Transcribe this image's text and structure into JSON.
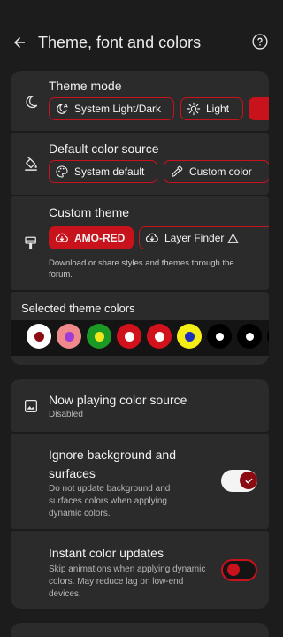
{
  "header": {
    "title": "Theme, font and colors",
    "back_icon": "arrow-back-icon",
    "help_icon": "help-circle-icon"
  },
  "theme_mode": {
    "title": "Theme mode",
    "icon": "moon-icon",
    "options": [
      {
        "label": "System Light/Dark",
        "icon": "moon-auto-icon"
      },
      {
        "label": "Light",
        "icon": "sun-icon"
      }
    ]
  },
  "default_color_source": {
    "title": "Default color source",
    "icon": "paint-bucket-icon",
    "options": [
      {
        "label": "System default",
        "icon": "palette-icon"
      },
      {
        "label": "Custom color",
        "icon": "eyedropper-icon"
      }
    ]
  },
  "custom_theme": {
    "title": "Custom theme",
    "icon": "brush-icon",
    "themes": [
      {
        "label": "AMO-RED",
        "icon": "cloud-download-icon"
      },
      {
        "label": "Layer Finder",
        "icon": "cloud-download-icon"
      }
    ],
    "description": "Download or share styles and themes through the forum."
  },
  "selected_theme_colors": {
    "title": "Selected theme colors",
    "swatches": [
      {
        "outer": "#ffffff",
        "inner": "#8a0b12"
      },
      {
        "outer": "#f08a8a",
        "inner": "#a23ad6"
      },
      {
        "outer": "#1a9a24",
        "inner": "#f2e61c"
      },
      {
        "outer": "#d1111c",
        "inner": "#ffffff"
      },
      {
        "outer": "#d1111c",
        "inner": "#ffffff"
      },
      {
        "outer": "#f4ee14",
        "inner": "#1a2fc0"
      },
      {
        "outer": "#000000",
        "inner": "#ffffff"
      },
      {
        "outer": "#000000",
        "inner": "#ffffff"
      },
      {
        "outer": "#000000",
        "inner": "#ffffff"
      }
    ]
  },
  "now_playing": {
    "title": "Now playing color source",
    "subtitle": "Disabled",
    "icon": "image-icon"
  },
  "ignore_background": {
    "title": "Ignore background and surfaces",
    "subtitle": "Do not update background and surfaces colors when applying dynamic colors.",
    "enabled": true
  },
  "instant_updates": {
    "title": "Instant color updates",
    "subtitle": "Skip animations when applying dynamic colors. May reduce lag on low-end devices.",
    "enabled": false
  },
  "colors": {
    "accent": "#c8121c",
    "card": "#2b2b2b",
    "background": "#1c1c1c"
  }
}
